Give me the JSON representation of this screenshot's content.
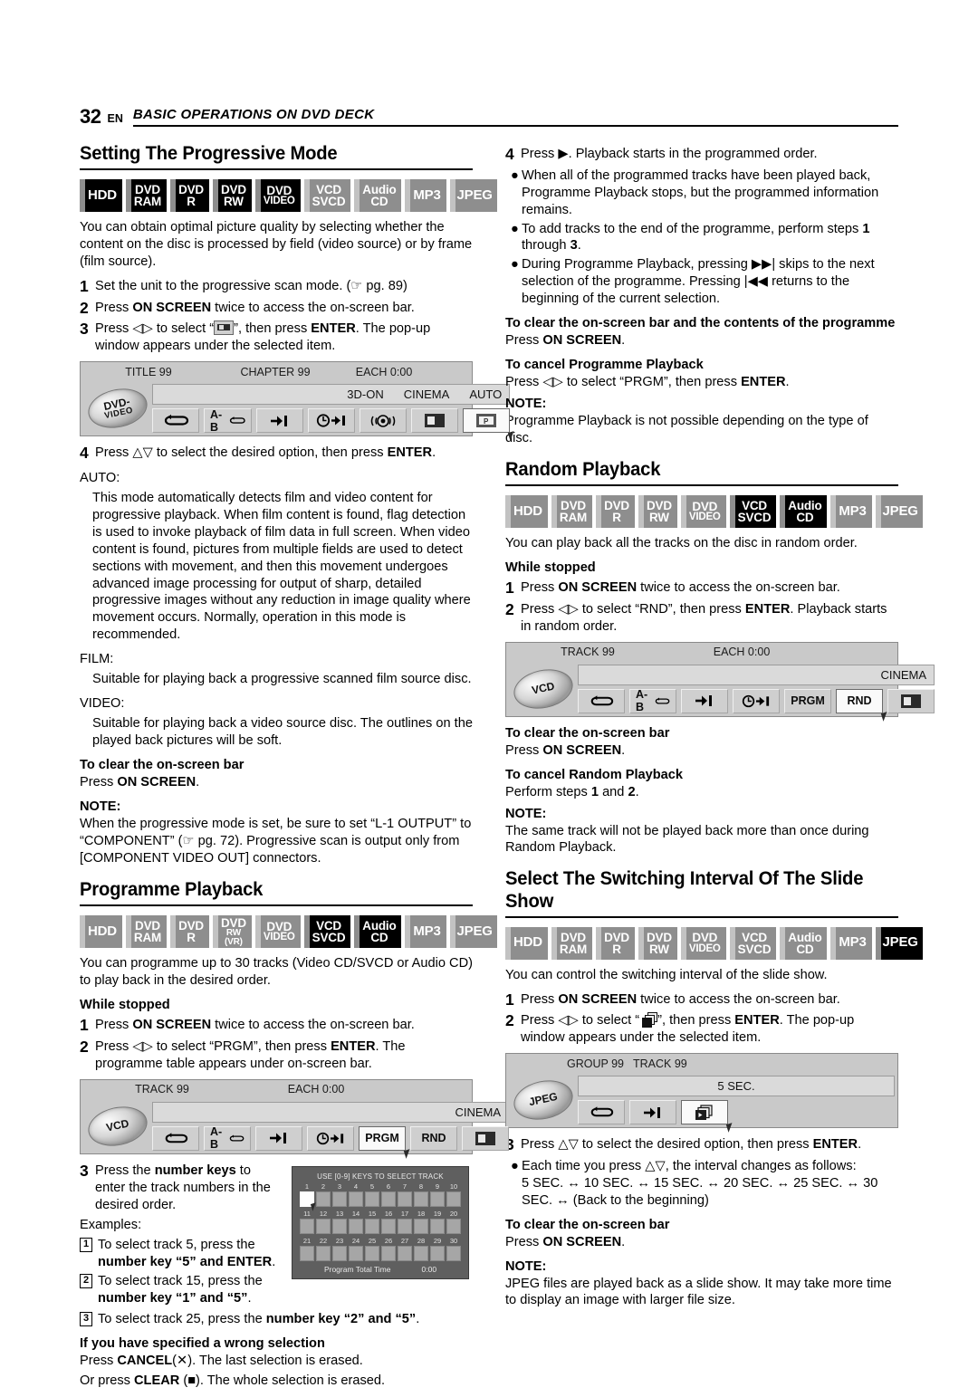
{
  "header": {
    "page_number": "32",
    "lang": "EN",
    "running_title": "BASIC OPERATIONS ON DVD DECK"
  },
  "media_labels": {
    "hdd": "HDD",
    "dvd": "DVD",
    "ram": "RAM",
    "r": "R",
    "rw": "RW",
    "rw_vr": "RW (VR)",
    "video": "VIDEO",
    "vcd": "VCD",
    "svcd": "SVCD",
    "audio": "Audio",
    "cd": "CD",
    "mp3": "MP3",
    "jpeg": "JPEG"
  },
  "sections": {
    "progressive": {
      "title": "Setting The Progressive Mode",
      "intro": "You can obtain optimal picture quality by selecting whether the content on the disc is processed by field (video source) or by frame (film source).",
      "step1": "Set the unit to the progressive scan mode. (☞ pg. 89)",
      "step2_a": "Press ",
      "step2_b": "ON SCREEN",
      "step2_c": " twice to access the on-screen bar.",
      "step3_a": "Press ◁▷ to select “",
      "step3_b": "”, then press ",
      "step3_c": "ENTER",
      "step3_d": ". The pop-up window appears under the selected item.",
      "step4_a": "Press △▽ to select the desired option, then press ",
      "step4_b": "ENTER",
      "step4_c": ".",
      "auto_label": "AUTO:",
      "auto_text": "This mode automatically detects film and video content for progressive playback. When film content is found, flag detection is used to invoke playback of film data in full screen. When video content is found, pictures from multiple fields are used to detect sections with movement, and then this movement undergoes advanced image processing for output of sharp, detailed progressive images without any reduction in image quality where movement occurs. Normally, operation in this mode is recommended.",
      "film_label": "FILM:",
      "film_text": "Suitable for playing back a progressive scanned film source disc.",
      "video_label": "VIDEO:",
      "video_text": "Suitable for playing back a video source disc. The outlines on the played back pictures will be soft.",
      "clear_head": "To clear the on-screen bar",
      "clear_a": "Press ",
      "clear_b": "ON SCREEN",
      "clear_c": ".",
      "note_head": "NOTE:",
      "note_text": "When the progressive mode is set, be sure to set “L-1 OUTPUT” to “COMPONENT” (☞ pg. 72). Progressive scan is output only from [COMPONENT VIDEO OUT] connectors."
    },
    "programme": {
      "title": "Programme Playback",
      "intro": "You can programme up to 30 tracks (Video CD/SVCD or Audio CD) to play back in the desired order.",
      "while_stopped": "While stopped",
      "step1_a": "Press ",
      "step1_b": "ON SCREEN",
      "step1_c": " twice to access the on-screen bar.",
      "step2_a": "Press ◁▷ to select “PRGM”, then press ",
      "step2_b": "ENTER",
      "step2_c": ". The programme table appears under on-screen bar.",
      "step3_a": "Press the ",
      "step3_b": "number keys",
      "step3_c": " to enter the track numbers in the desired order.",
      "examples": "Examples:",
      "ex1_num": "1",
      "ex1_a": "To select track 5, press the ",
      "ex1_b": "number key “5” and ENTER",
      "ex1_c": ".",
      "ex2_num": "2",
      "ex2_a": "To select track 15, press the ",
      "ex2_b": "number key “1” and “5”",
      "ex2_c": ".",
      "ex3_num": "3",
      "ex3_a": "To select track 25, press the ",
      "ex3_b": "number key “2” and “5”",
      "ex3_c": ".",
      "wrong_head": "If you have specified a wrong selection",
      "wrong_1a": "Press ",
      "wrong_1b": "CANCEL",
      "wrong_1c": "(✕). The last selection is erased.",
      "wrong_2a": "Or press ",
      "wrong_2b": "CLEAR",
      "wrong_2c": " (■). The whole selection is erased."
    },
    "programme_cont": {
      "step4_a": "Press ▶. Playback starts in the programmed order.",
      "b1": "When all of the programmed tracks have been played back, Programme Playback stops, but the programmed information remains.",
      "b2_a": "To add tracks to the end of the programme, perform steps ",
      "b2_b": "1",
      "b2_c": " through ",
      "b2_d": "3",
      "b2_e": ".",
      "b3": "During Programme Playback, pressing ▶▶| skips to the next selection of the programme. Pressing |◀◀ returns to the beginning of the current selection.",
      "clear_head": "To clear the on-screen bar and the contents of the programme",
      "clear_a": "Press ",
      "clear_b": "ON SCREEN",
      "clear_c": ".",
      "cancel_head": "To cancel Programme Playback",
      "cancel_a": "Press ◁▷ to select “PRGM”, then press ",
      "cancel_b": "ENTER",
      "cancel_c": ".",
      "note_head": "NOTE:",
      "note_text": "Programme Playback is not possible depending on the type of disc."
    },
    "random": {
      "title": "Random Playback",
      "intro": "You can play back all the tracks on the disc in random order.",
      "while_stopped": "While stopped",
      "step1_a": "Press ",
      "step1_b": "ON SCREEN",
      "step1_c": " twice to access the on-screen bar.",
      "step2_a": "Press ◁▷ to select “RND”, then press ",
      "step2_b": "ENTER",
      "step2_c": ". Playback starts in random order.",
      "clear_head": "To clear the on-screen bar",
      "clear_a": "Press ",
      "clear_b": "ON SCREEN",
      "clear_c": ".",
      "cancel_head": "To cancel Random Playback",
      "cancel_a": "Perform steps ",
      "cancel_b": "1",
      "cancel_c": " and ",
      "cancel_d": "2",
      "cancel_e": ".",
      "note_head": "NOTE:",
      "note_text": "The same track will not be played back more than once during Random Playback."
    },
    "slideshow": {
      "title": "Select The Switching Interval Of The Slide Show",
      "intro": "You can control the switching interval of the slide show.",
      "step1_a": "Press ",
      "step1_b": "ON SCREEN",
      "step1_c": " twice to access the on-screen bar.",
      "step2_a": "Press ◁▷ to select “",
      "step2_b": "”, then press ",
      "step2_c": "ENTER",
      "step2_d": ". The pop-up window appears under the selected item.",
      "step3_a": "Press △▽ to select the desired option, then press ",
      "step3_b": "ENTER",
      "step3_c": ".",
      "b1_a": "Each time you press △▽, the interval changes as follows:",
      "b1_b": "5 SEC. ↔ 10 SEC. ↔ 15 SEC. ↔ 20 SEC. ↔ 25 SEC. ↔ 30 SEC. ↔ (Back to the beginning)",
      "clear_head": "To clear the on-screen bar",
      "clear_a": "Press ",
      "clear_b": "ON SCREEN",
      "clear_c": ".",
      "note_head": "NOTE:",
      "note_text": "JPEG files are played back as a slide show. It may take more time to display an image with larger file size."
    }
  },
  "figures": {
    "dvd_bar": {
      "top": [
        "TITLE 99",
        "CHAPTER 99",
        "EACH 0:00"
      ],
      "disc_line1": "DVD-",
      "disc_line2": "VIDEO",
      "status": [
        "3D-ON",
        "CINEMA",
        "AUTO"
      ],
      "buttons": [
        "repeat",
        "a-b-repeat",
        "skip-to",
        "time-search",
        "audio",
        "zoom",
        "progressive"
      ]
    },
    "vcd_bar_prgm": {
      "top": [
        "TRACK 99",
        "EACH 0:00"
      ],
      "disc_label": "VCD",
      "status": [
        "CINEMA"
      ],
      "buttons": [
        "repeat",
        "a-b-repeat",
        "skip-to",
        "time-search",
        "PRGM",
        "RND",
        "zoom"
      ],
      "prgm_label": "PRGM",
      "rnd_label": "RND",
      "selected": "PRGM"
    },
    "vcd_bar_rnd": {
      "top": [
        "TRACK 99",
        "EACH 0:00"
      ],
      "disc_label": "VCD",
      "status": [
        "CINEMA"
      ],
      "prgm_label": "PRGM",
      "rnd_label": "RND",
      "selected": "RND"
    },
    "jpeg_bar": {
      "top": [
        "GROUP 99",
        "TRACK 99"
      ],
      "disc_label": "JPEG",
      "status": [
        "5 SEC."
      ],
      "buttons": [
        "repeat",
        "skip-to",
        "slide-interval"
      ]
    },
    "track_table": {
      "caption": "USE [0-9] KEYS TO SELECT TRACK",
      "rows": [
        [
          "1",
          "2",
          "3",
          "4",
          "5",
          "6",
          "7",
          "8",
          "9",
          "10"
        ],
        [
          "11",
          "12",
          "13",
          "14",
          "15",
          "16",
          "17",
          "18",
          "19",
          "20"
        ],
        [
          "21",
          "22",
          "23",
          "24",
          "25",
          "26",
          "27",
          "28",
          "29",
          "30"
        ]
      ],
      "footer_label": "Program Total Time",
      "footer_value": "0:00"
    }
  },
  "badge_states": {
    "progressive": [
      "on",
      "on",
      "on",
      "on",
      "on",
      "off",
      "off",
      "off",
      "off"
    ],
    "programme": [
      "off",
      "off",
      "off",
      "off",
      "off",
      "on",
      "on",
      "off",
      "off"
    ],
    "random": [
      "off",
      "off",
      "off",
      "off",
      "off",
      "on",
      "on",
      "off",
      "off"
    ],
    "slideshow": [
      "off",
      "off",
      "off",
      "off",
      "off",
      "off",
      "off",
      "off",
      "on"
    ]
  }
}
